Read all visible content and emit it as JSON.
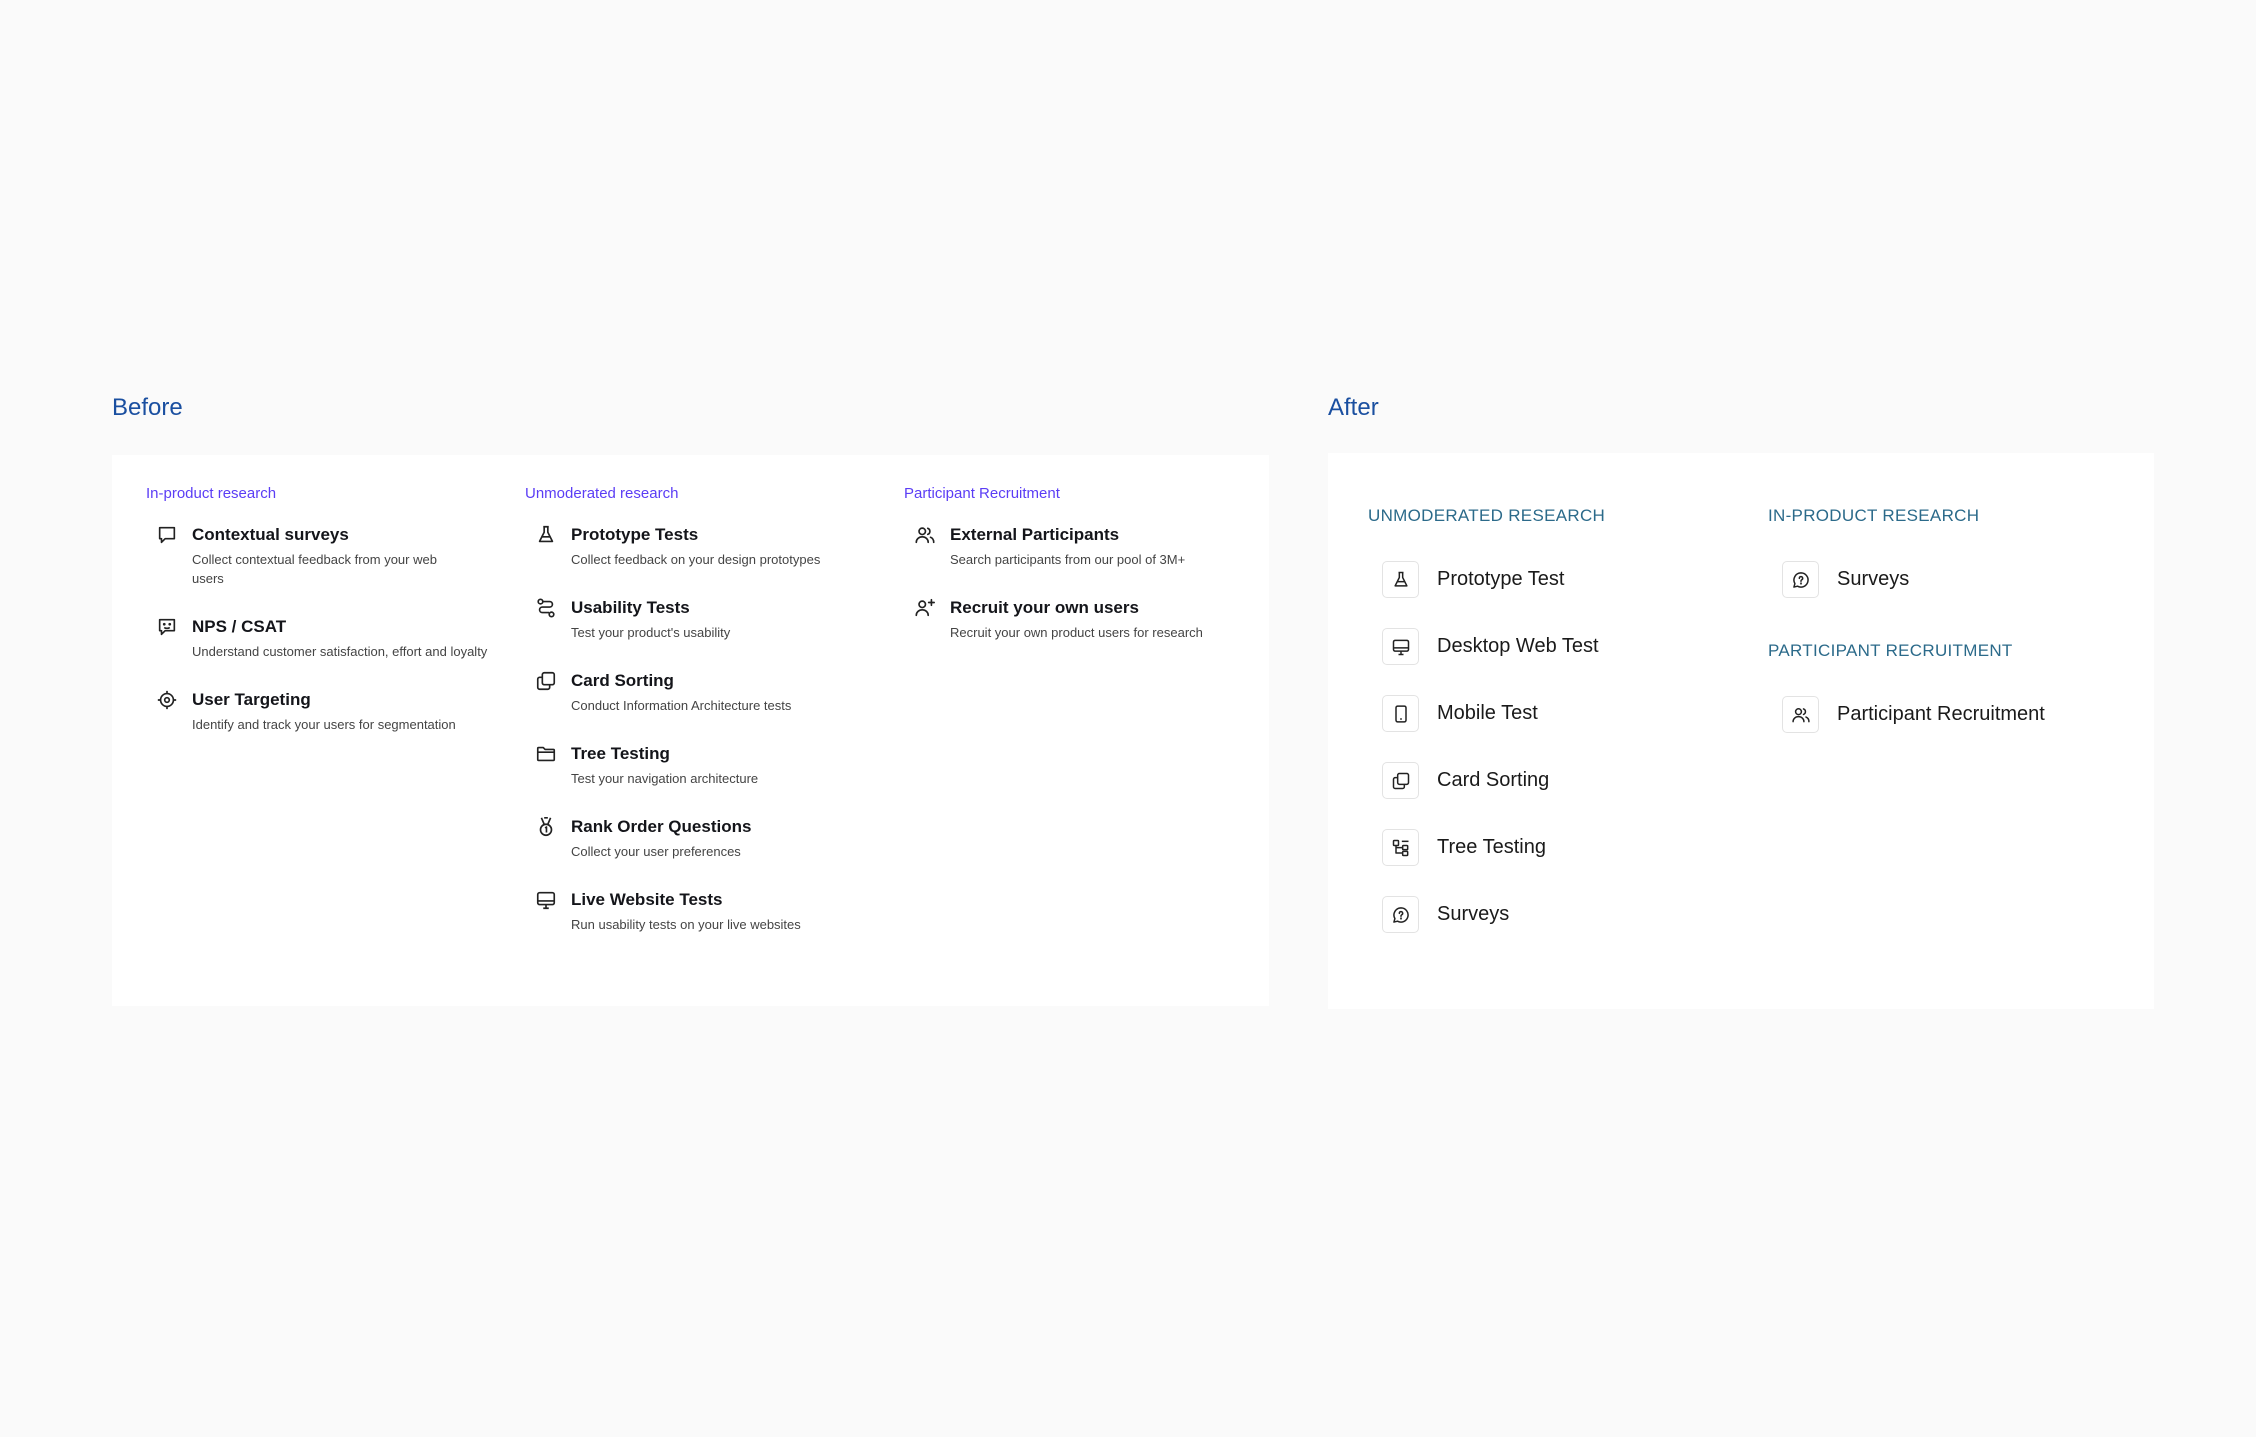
{
  "before": {
    "title": "Before",
    "columns": [
      {
        "heading": "In-product research",
        "items": [
          {
            "title": "Contextual surveys",
            "desc": "Collect contextual feedback from your web users",
            "icon": "chat-bubble-icon"
          },
          {
            "title": "NPS / CSAT",
            "desc": "Understand customer satisfaction, effort and loyalty",
            "icon": "smiley-chat-icon"
          },
          {
            "title": "User Targeting",
            "desc": "Identify and track your users for segmentation",
            "icon": "target-icon"
          }
        ]
      },
      {
        "heading": "Unmoderated research",
        "items": [
          {
            "title": "Prototype Tests",
            "desc": "Collect feedback on your design prototypes",
            "icon": "flask-icon"
          },
          {
            "title": "Usability Tests",
            "desc": "Test your product's usability",
            "icon": "route-icon"
          },
          {
            "title": "Card Sorting",
            "desc": "Conduct Information Architecture tests",
            "icon": "cards-icon"
          },
          {
            "title": "Tree Testing",
            "desc": "Test your navigation architecture",
            "icon": "folder-icon"
          },
          {
            "title": "Rank Order Questions",
            "desc": "Collect your user preferences",
            "icon": "medal-icon"
          },
          {
            "title": "Live Website Tests",
            "desc": "Run usability tests on your live websites",
            "icon": "monitor-icon"
          }
        ]
      },
      {
        "heading": "Participant Recruitment",
        "items": [
          {
            "title": "External Participants",
            "desc": "Search participants from our pool of 3M+",
            "icon": "users-icon"
          },
          {
            "title": "Recruit your own users",
            "desc": "Recruit your own product users for research",
            "icon": "user-plus-icon"
          }
        ]
      }
    ]
  },
  "after": {
    "title": "After",
    "unmoderated": {
      "heading": "UNMODERATED RESEARCH",
      "items": [
        {
          "label": "Prototype Test",
          "icon": "flask-icon"
        },
        {
          "label": "Desktop Web Test",
          "icon": "monitor-icon"
        },
        {
          "label": "Mobile Test",
          "icon": "mobile-icon"
        },
        {
          "label": "Card Sorting",
          "icon": "cards-icon"
        },
        {
          "label": "Tree Testing",
          "icon": "tree-icon"
        },
        {
          "label": "Surveys",
          "icon": "question-chat-icon"
        }
      ]
    },
    "in_product": {
      "heading": "IN-PRODUCT RESEARCH",
      "items": [
        {
          "label": "Surveys",
          "icon": "question-chat-icon"
        }
      ]
    },
    "recruitment": {
      "heading": "PARTICIPANT RECRUITMENT",
      "items": [
        {
          "label": "Participant Recruitment",
          "icon": "users-icon"
        }
      ]
    }
  }
}
